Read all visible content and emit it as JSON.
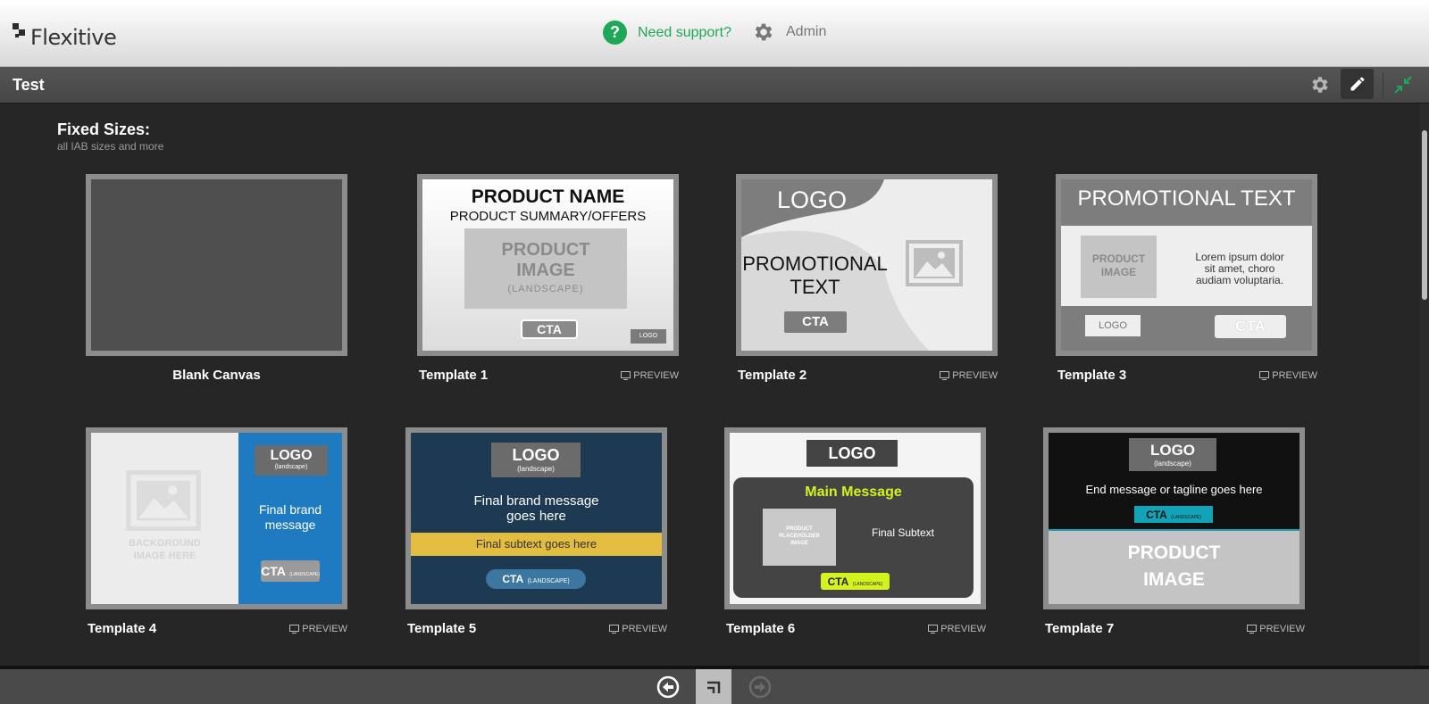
{
  "header": {
    "brand": "Flexitive",
    "support_label": "Need support?",
    "admin_label": "Admin"
  },
  "titlebar": {
    "title": "Test"
  },
  "section": {
    "title": "Fixed Sizes:",
    "subtitle": "all IAB sizes and more"
  },
  "preview_label": "PREVIEW",
  "cards": [
    {
      "name": "Blank Canvas"
    },
    {
      "name": "Template 1",
      "product_name": "PRODUCT NAME",
      "summary": "PRODUCT SUMMARY/OFFERS",
      "image_l1": "PRODUCT",
      "image_l2": "IMAGE",
      "image_l3": "(LANDSCAPE)",
      "cta": "CTA",
      "logo": "LOGO"
    },
    {
      "name": "Template 2",
      "logo": "LOGO",
      "promo_l1": "PROMOTIONAL",
      "promo_l2": "TEXT",
      "cta": "CTA"
    },
    {
      "name": "Template 3",
      "promo": "PROMOTIONAL TEXT",
      "image_l1": "PRODUCT",
      "image_l2": "IMAGE",
      "lorem_l1": "Lorem ipsum dolor",
      "lorem_l2": "sit amet, choro",
      "lorem_l3": "audiam voluptaria.",
      "logo": "LOGO",
      "cta": "CTA"
    },
    {
      "name": "Template 4",
      "bg_l1": "BACKGROUND",
      "bg_l2": "IMAGE HERE",
      "logo": "LOGO",
      "logo_sub": "(landscape)",
      "msg_l1": "Final brand",
      "msg_l2": "message",
      "cta": "CTA",
      "cta_sub": "(LANDSCAPE)"
    },
    {
      "name": "Template 5",
      "logo": "LOGO",
      "logo_sub": "(landscape)",
      "msg_l1": "Final brand message",
      "msg_l2": "goes here",
      "subtext": "Final subtext goes here",
      "cta": "CTA",
      "cta_sub": "(LANDSCAPE)"
    },
    {
      "name": "Template 6",
      "logo": "LOGO",
      "main": "Main Message",
      "ph_l1": "PRODUCT",
      "ph_l2": "PLACEHOLDER",
      "ph_l3": "IMAGE",
      "subtext": "Final Subtext",
      "cta": "CTA",
      "cta_sub": "(LANDSCAPE)"
    },
    {
      "name": "Template 7",
      "logo": "LOGO",
      "logo_sub": "(landscape)",
      "tagline": "End message or tagline goes here",
      "cta": "CTA",
      "cta_sub": "(LANDSCAPE)",
      "image_l1": "PRODUCT",
      "image_l2": "IMAGE"
    }
  ],
  "colors": {
    "accent_green": "#1fa758",
    "template4_blue": "#1f7bc1",
    "template5_navy": "#1e3a52",
    "template5_yellow": "#e2bd3f",
    "template6_lime": "#d4f21e",
    "template7_teal": "#13a3b8"
  }
}
